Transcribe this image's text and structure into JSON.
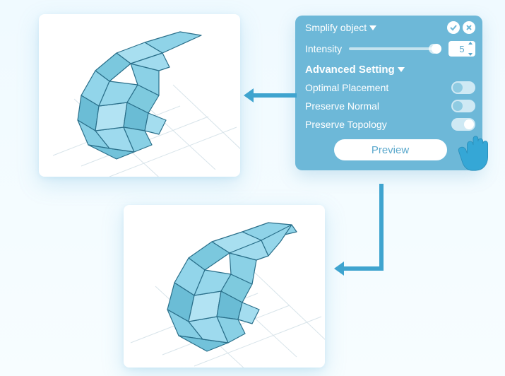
{
  "panel": {
    "title": "Smplify object",
    "intensity_label": "Intensity",
    "intensity_value": "5",
    "advanced_title": "Advanced Setting",
    "options": [
      {
        "label": "Optimal Placement",
        "on": false
      },
      {
        "label": "Preserve  Normal",
        "on": false
      },
      {
        "label": "Preserve  Topology",
        "on": true
      }
    ],
    "preview_label": "Preview"
  }
}
